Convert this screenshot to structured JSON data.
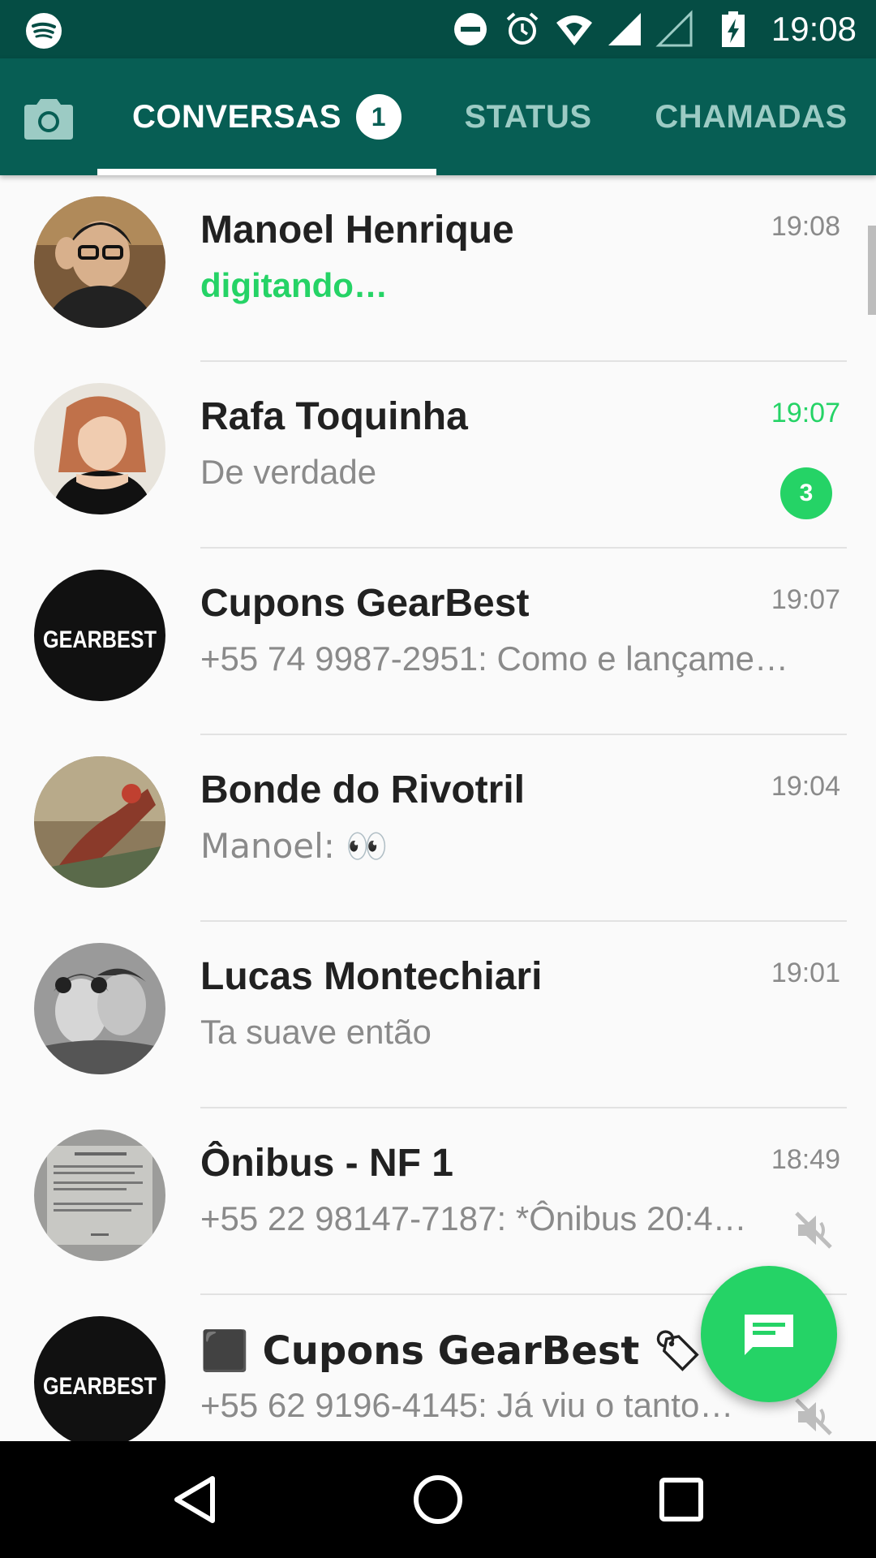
{
  "status_bar": {
    "time": "19:08",
    "left_icon": "spotify-icon",
    "right_icons": [
      "do-not-disturb-icon",
      "alarm-icon",
      "wifi-icon",
      "signal-icon",
      "signal-empty-icon",
      "battery-charging-icon"
    ]
  },
  "tabs": {
    "camera_icon": "camera-icon",
    "items": [
      {
        "label": "CONVERSAS",
        "badge": "1",
        "active": true
      },
      {
        "label": "STATUS"
      },
      {
        "label": "CHAMADAS"
      }
    ]
  },
  "chats": [
    {
      "name": "Manoel Henrique",
      "time": "19:08",
      "message": "digitando…",
      "typing": true
    },
    {
      "name": "Rafa Toquinha",
      "time": "19:07",
      "message": "De verdade",
      "unread": "3"
    },
    {
      "name": "Cupons GearBest",
      "time": "19:07",
      "message": "+55 74 9987-2951: Como e lançame…",
      "avatar_text": "GEARBEST"
    },
    {
      "name": "Bonde do Rivotril",
      "time": "19:04",
      "message": "Manoel: 👀"
    },
    {
      "name": "Lucas Montechiari",
      "time": "19:01",
      "message": "Ta suave então"
    },
    {
      "name": "Ônibus - NF 1",
      "time": "18:49",
      "message": "+55 22 98147-7187: *Ônibus 20:4…",
      "muted": true
    },
    {
      "name": "⬛ Cupons GearBest 🏷",
      "time": "",
      "message": "+55 62 9196-4145: Já viu o tanto…",
      "muted": true,
      "avatar_text": "GEARBEST"
    }
  ],
  "fab": {
    "icon": "new-chat-icon"
  },
  "nav": {
    "icons": [
      "back-icon",
      "home-icon",
      "recents-icon"
    ]
  },
  "colors": {
    "primary": "#075e54",
    "status_bar": "#054d44",
    "accent": "#25d366"
  }
}
